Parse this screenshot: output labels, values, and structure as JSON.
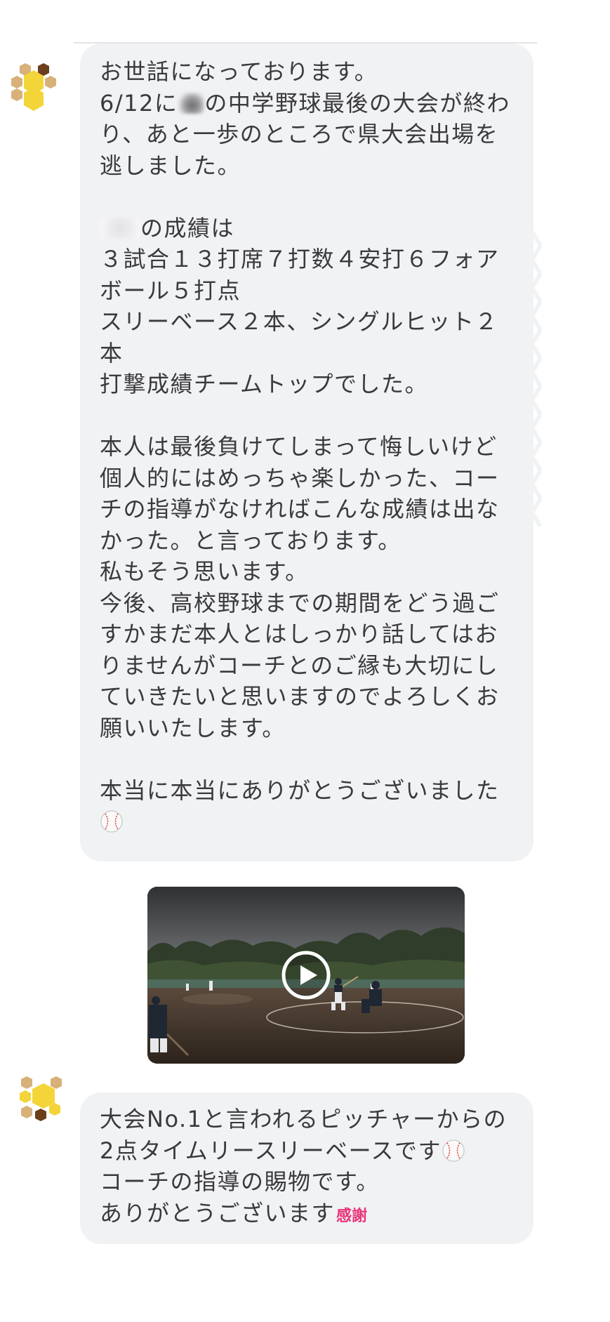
{
  "message1": {
    "lines": [
      "お世話になっております。",
      [
        "6/12に",
        "の中学野球最後の大会が終わ"
      ],
      "り、あと一歩のところで県大会出場を",
      "逃しました。",
      "",
      [
        "",
        "の成績は"
      ],
      "３試合１３打席７打数４安打６フォア",
      "ボール５打点",
      "スリーベース２本、シングルヒット２",
      "本",
      "打撃成績チームトップでした。",
      "",
      "本人は最後負けてしまって悔しいけど",
      "個人的にはめっちゃ楽しかった、コー",
      "チの指導がなければこんな成績は出な",
      "かった。と言っております。",
      "私もそう思います。",
      "今後、高校野球までの期間をどう過ご",
      "すかまだ本人とはしっかり話してはお",
      "りませんがコーチとのご縁も大切にし",
      "ていきたいと思いますのでよろしくお",
      "願いいたします。",
      "",
      "本当に本当にありがとうございました"
    ],
    "trailing_emoji": "baseball-emoji"
  },
  "video": {
    "icon": "play-icon"
  },
  "message2": {
    "lines": [
      "大会No.1と言われるピッチャーからの",
      "2点タイムリースリーベースです",
      "コーチの指導の賜物です。",
      "ありがとうございます"
    ],
    "line2_emoji": "baseball-emoji",
    "line4_sticker": "感謝"
  },
  "colors": {
    "bubble": "#f1f2f4",
    "text": "#3a3a3c",
    "avatar_yellow": "#f3d53a",
    "avatar_tan": "#d8b07a",
    "avatar_brown": "#6b3e1c",
    "sticker_pink": "#e8357a"
  }
}
